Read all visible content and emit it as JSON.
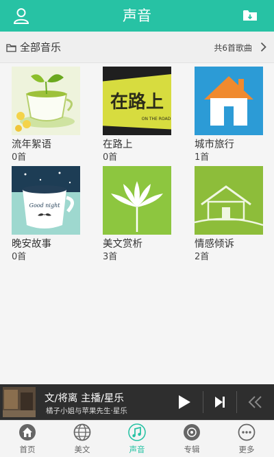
{
  "header": {
    "title": "声音"
  },
  "section": {
    "label": "全部音乐",
    "count": "共6首歌曲"
  },
  "albums": [
    {
      "name": "流年絮语",
      "count": "0首"
    },
    {
      "name": "在路上",
      "count": "0首"
    },
    {
      "name": "城市旅行",
      "count": "1首"
    },
    {
      "name": "晚安故事",
      "count": "0首"
    },
    {
      "name": "美文赏析",
      "count": "3首"
    },
    {
      "name": "情感倾诉",
      "count": "2首"
    }
  ],
  "cover_text": {
    "road_main": "在路上",
    "road_sub": "ON THE ROAD",
    "mug": "Good night"
  },
  "player": {
    "track": "文/将离  主播/星乐",
    "artist": "橘子小姐与苹果先生·星乐"
  },
  "tabs": [
    {
      "label": "首页",
      "icon": "home-icon"
    },
    {
      "label": "美文",
      "icon": "globe-icon"
    },
    {
      "label": "声音",
      "icon": "music-note-icon"
    },
    {
      "label": "专辑",
      "icon": "disc-icon"
    },
    {
      "label": "更多",
      "icon": "more-icon"
    }
  ],
  "colors": {
    "accent": "#27c2a4",
    "player_bg": "#2e2e2e",
    "tab_active": "#27c2a4"
  }
}
